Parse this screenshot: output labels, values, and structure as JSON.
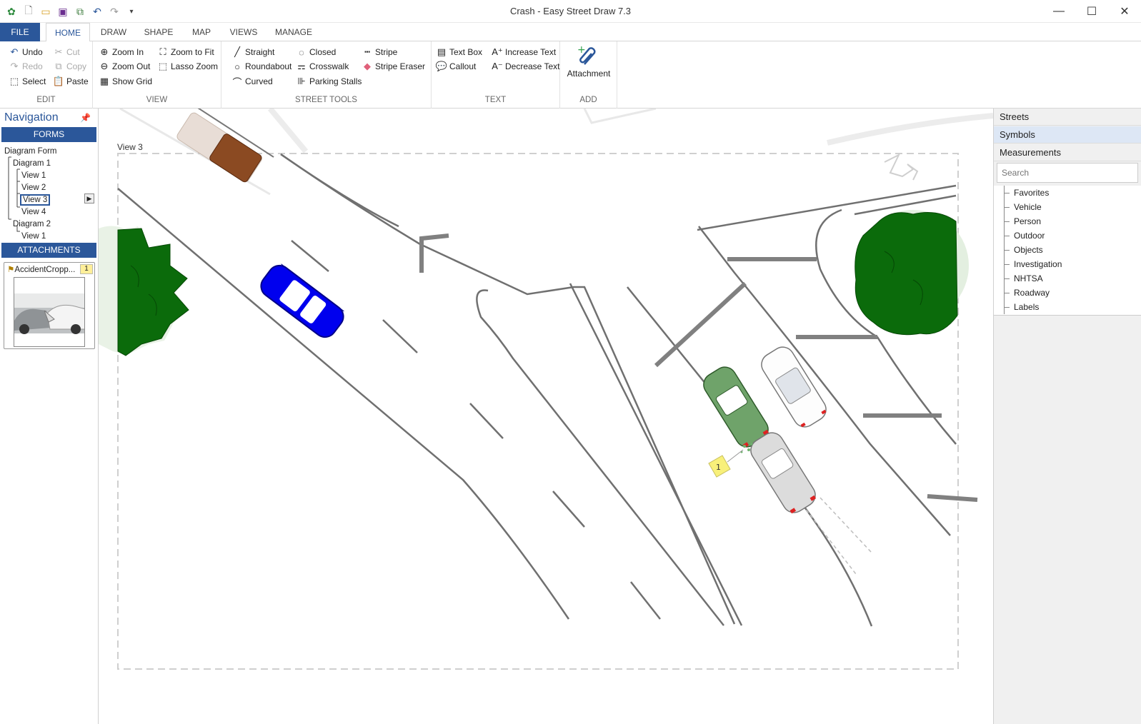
{
  "window": {
    "title": "Crash - Easy Street Draw 7.3",
    "controls": [
      "minimize",
      "maximize",
      "close"
    ]
  },
  "quick_access": [
    "app-icon",
    "new-icon",
    "open-icon",
    "save-icon",
    "save-as-icon",
    "undo-icon",
    "redo-icon",
    "customize-icon"
  ],
  "tabs": [
    "FILE",
    "HOME",
    "DRAW",
    "SHAPE",
    "MAP",
    "VIEWS",
    "MANAGE"
  ],
  "active_tab": "HOME",
  "ribbon": {
    "edit": {
      "label": "EDIT",
      "undo": "Undo",
      "redo": "Redo",
      "select": "Select",
      "cut": "Cut",
      "copy": "Copy",
      "paste": "Paste"
    },
    "view": {
      "label": "VIEW",
      "zoom_in": "Zoom In",
      "zoom_out": "Zoom Out",
      "show_grid": "Show Grid",
      "zoom_fit": "Zoom to Fit",
      "lasso_zoom": "Lasso Zoom"
    },
    "street_tools": {
      "label": "STREET TOOLS",
      "straight": "Straight",
      "roundabout": "Roundabout",
      "curved": "Curved",
      "closed": "Closed",
      "crosswalk": "Crosswalk",
      "parking_stalls": "Parking Stalls",
      "stripe": "Stripe",
      "stripe_eraser": "Stripe Eraser"
    },
    "text": {
      "label": "TEXT",
      "text_box": "Text Box",
      "callout": "Callout",
      "increase_text": "Increase Text",
      "decrease_text": "Decrease Text"
    },
    "add": {
      "label": "ADD",
      "attachment": "Attachment"
    }
  },
  "navigation": {
    "title": "Navigation",
    "forms_header": "FORMS",
    "tree": {
      "root": "Diagram Form",
      "diagram1": "Diagram 1",
      "d1_view1": "View 1",
      "d1_view2": "View 2",
      "d1_view3": "View 3",
      "d1_view4": "View 4",
      "diagram2": "Diagram 2",
      "d2_view1": "View 1"
    },
    "attachments_header": "ATTACHMENTS",
    "attachment": {
      "name": "AccidentCropp...",
      "count": "1"
    }
  },
  "canvas": {
    "view_label": "View 3",
    "marker_label": "1",
    "vehicle_colors": {
      "pickup": "#8b4a22",
      "blue_car": "#0000ee",
      "green_car": "#6fa36a",
      "white_car": "#ffffff",
      "gray_car": "#cfcfcf"
    },
    "tree_color": "#0b6b0b"
  },
  "right_panel": {
    "tabs": [
      "Streets",
      "Symbols",
      "Measurements"
    ],
    "active": "Symbols",
    "search_placeholder": "Search",
    "categories": [
      "Favorites",
      "Vehicle",
      "Person",
      "Outdoor",
      "Objects",
      "Investigation",
      "NHTSA",
      "Roadway",
      "Labels"
    ]
  }
}
